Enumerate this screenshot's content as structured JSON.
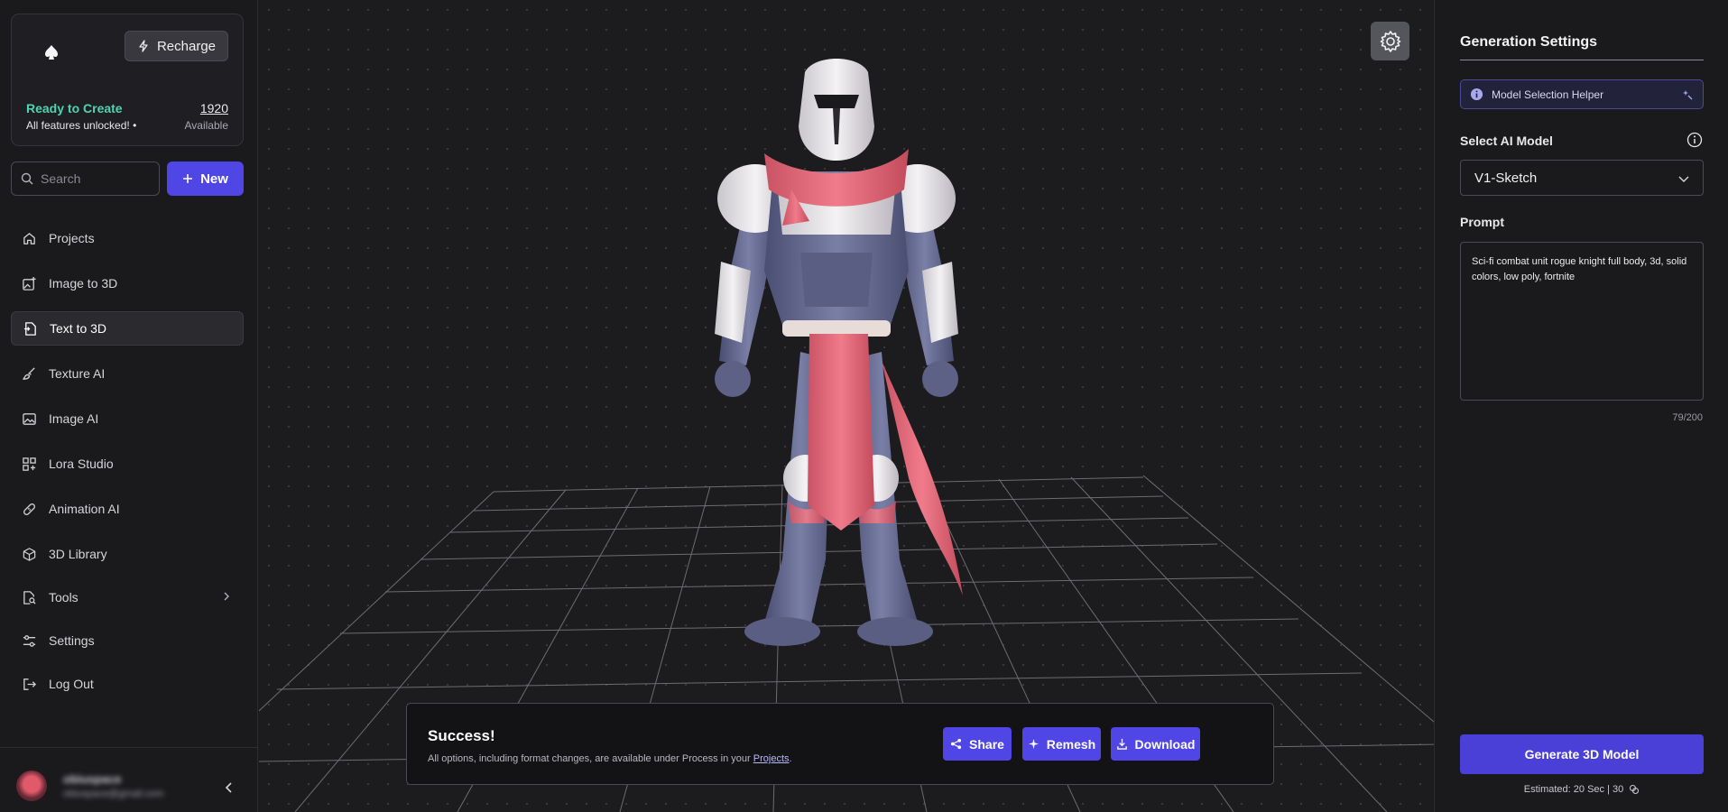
{
  "sidebar": {
    "recharge_label": "Recharge",
    "status_title": "Ready to Create",
    "status_sub": "All features unlocked! •",
    "credits": "1920",
    "credits_label": "Available",
    "search_placeholder": "Search",
    "new_label": "New",
    "nav": [
      {
        "label": "Projects",
        "icon": "home-icon"
      },
      {
        "label": "Image to 3D",
        "icon": "image-plus-icon"
      },
      {
        "label": "Text to 3D",
        "icon": "file-text-icon",
        "active": true
      },
      {
        "label": "Texture AI",
        "icon": "brush-icon"
      },
      {
        "label": "Image AI",
        "icon": "image-icon"
      },
      {
        "label": "Lora Studio",
        "icon": "grid-icon"
      },
      {
        "label": "Animation AI",
        "icon": "bandage-icon"
      },
      {
        "label": "3D Library",
        "icon": "cube-icon"
      },
      {
        "label": "Tools",
        "icon": "file-search-icon"
      },
      {
        "label": "Settings",
        "icon": "sliders-icon"
      },
      {
        "label": "Log Out",
        "icon": "logout-icon"
      }
    ],
    "user": {
      "name": "obiuspace",
      "email": "obiuspace@gmail.com"
    }
  },
  "toast": {
    "title": "Success!",
    "message": "All options, including format changes, are available under Process in your ",
    "link": "Projects",
    "message_end": ".",
    "share_label": "Share",
    "remesh_label": "Remesh",
    "download_label": "Download"
  },
  "settings": {
    "title": "Generation Settings",
    "helper_label": "Model Selection Helper",
    "model_label": "Select AI Model",
    "model_value": "V1-Sketch",
    "prompt_label": "Prompt",
    "prompt_value": "Sci-fi combat unit rogue knight full body, 3d, solid colors, low poly, fortnite",
    "counter": "79/200",
    "generate_label": "Generate 3D Model",
    "estimate": "Estimated: 20 Sec | 30"
  },
  "colors": {
    "accent": "#4f46e5",
    "ready": "#4fd3b4",
    "background": "#1c1c1f"
  }
}
